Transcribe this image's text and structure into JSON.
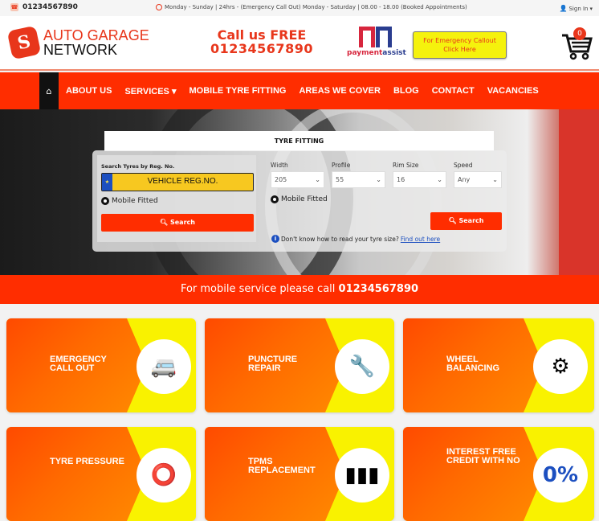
{
  "topbar": {
    "phone": "01234567890",
    "hours": "Monday - Sunday | 24hrs - (Emergency Call Out) Monday - Saturday | 08.00 - 18.00 (Booked Appointments)",
    "signin": "Sign In"
  },
  "header": {
    "logo_line1": "AUTO GARAGE",
    "logo_line2": "NETWORK",
    "call_line1": "Call us FREE",
    "call_line2": "01234567890",
    "payment_a": "payment",
    "payment_b": "assist",
    "emergency_line1": "For Emergency Callout",
    "emergency_line2": "Click Here",
    "cart_count": "0"
  },
  "nav": {
    "items": [
      "ABOUT US",
      "SERVICES ▾",
      "MOBILE TYRE FITTING",
      "AREAS WE COVER",
      "BLOG",
      "CONTACT",
      "VACANCIES"
    ]
  },
  "search": {
    "tab": "TYRE FITTING",
    "reg_label": "Search Tyres by Reg. No.",
    "reg_placeholder": "VEHICLE REG.NO.",
    "mobile_fitted": "Mobile Fitted",
    "search_label": "Search",
    "fields": [
      {
        "label": "Width",
        "value": "205"
      },
      {
        "label": "Profile",
        "value": "55"
      },
      {
        "label": "Rim Size",
        "value": "16"
      },
      {
        "label": "Speed",
        "value": "Any"
      }
    ],
    "help_text": "Don't know how to read your tyre size?",
    "help_link": "Find out here"
  },
  "callbar": {
    "text": "For mobile service please call ",
    "phone": "01234567890"
  },
  "cards": [
    {
      "title": "EMERGENCY CALL OUT",
      "icon": "🚐"
    },
    {
      "title": "PUNCTURE REPAIR",
      "icon": "🔧"
    },
    {
      "title": "WHEEL BALANCING",
      "icon": "⚙"
    },
    {
      "title": "TYRE PRESSURE",
      "icon": "⭕"
    },
    {
      "title": "TPMS REPLACEMENT",
      "icon": "▮▮▮"
    },
    {
      "title": "INTEREST FREE CREDIT WITH NO",
      "icon": "0%"
    }
  ]
}
